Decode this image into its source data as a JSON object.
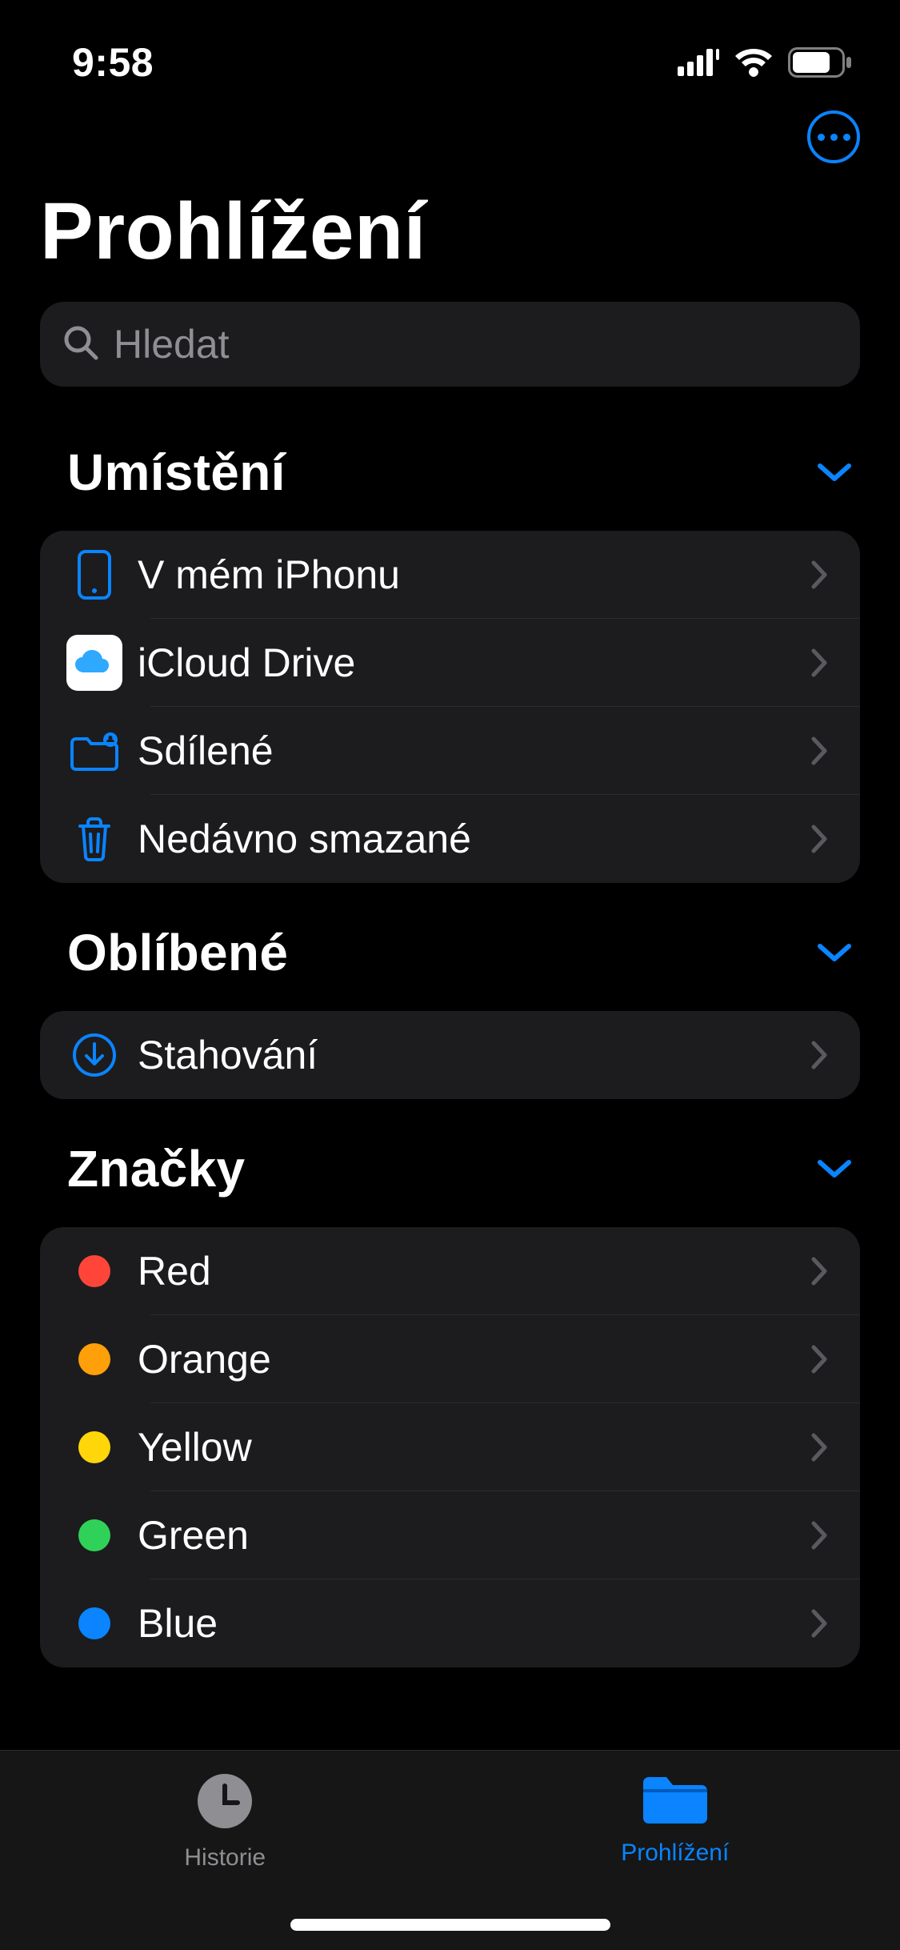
{
  "status": {
    "time": "9:58"
  },
  "nav": {
    "more_button": "more-options"
  },
  "page_title": "Prohlížení",
  "search": {
    "placeholder": "Hledat"
  },
  "sections": {
    "locations": {
      "title": "Umístění",
      "items": [
        {
          "label": "V mém iPhonu",
          "icon": "iphone-icon"
        },
        {
          "label": "iCloud Drive",
          "icon": "icloud-icon"
        },
        {
          "label": "Sdílené",
          "icon": "shared-folder-icon"
        },
        {
          "label": "Nedávno smazané",
          "icon": "trash-icon"
        }
      ]
    },
    "favorites": {
      "title": "Oblíbené",
      "items": [
        {
          "label": "Stahování",
          "icon": "download-icon"
        }
      ]
    },
    "tags": {
      "title": "Značky",
      "items": [
        {
          "label": "Red",
          "color": "#ff453a"
        },
        {
          "label": "Orange",
          "color": "#ff9f0a"
        },
        {
          "label": "Yellow",
          "color": "#ffd60a"
        },
        {
          "label": "Green",
          "color": "#30d158"
        },
        {
          "label": "Blue",
          "color": "#0a84ff"
        }
      ]
    }
  },
  "tabs": {
    "history": "Historie",
    "browse": "Prohlížení"
  },
  "colors": {
    "accent": "#0a84ff",
    "bg": "#000000",
    "card": "#1c1c1e",
    "muted": "#8e8e93"
  }
}
